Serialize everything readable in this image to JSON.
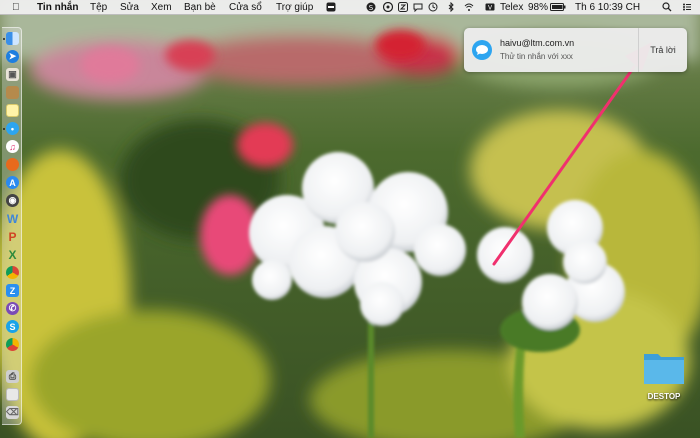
{
  "menubar": {
    "app_name": "Tin nhắn",
    "menus": [
      "Tệp",
      "Sửa",
      "Xem",
      "Bạn bè",
      "Cửa sổ",
      "Trợ giúp"
    ],
    "input_method": "Telex",
    "battery": "98%",
    "clock": "Th 6 10:39 CH"
  },
  "notification": {
    "sender": "haivu@ltm.com.vn",
    "message": "Thử tin nhắn với xxx",
    "reply_label": "Trả lời"
  },
  "desktop": {
    "folder_label": "DESTOP"
  },
  "colors": {
    "arrow": "#f0306e",
    "folder": "#5ab8ea",
    "dock_bg": "rgba(225,225,225,0.35)"
  },
  "dock": {
    "icons": [
      "finder-icon",
      "safari-icon",
      "preview-icon",
      "notes-icon",
      "stickies-icon",
      "messages-icon",
      "itunes-icon",
      "firefox-icon",
      "app-store-icon",
      "camera-icon",
      "word-icon",
      "powerpoint-icon",
      "excel-icon",
      "chrome-icon",
      "zalo-icon",
      "viber-icon",
      "skype-icon",
      "chrome-canary-icon",
      "printer-icon",
      "documents-icon",
      "trash-icon"
    ]
  }
}
